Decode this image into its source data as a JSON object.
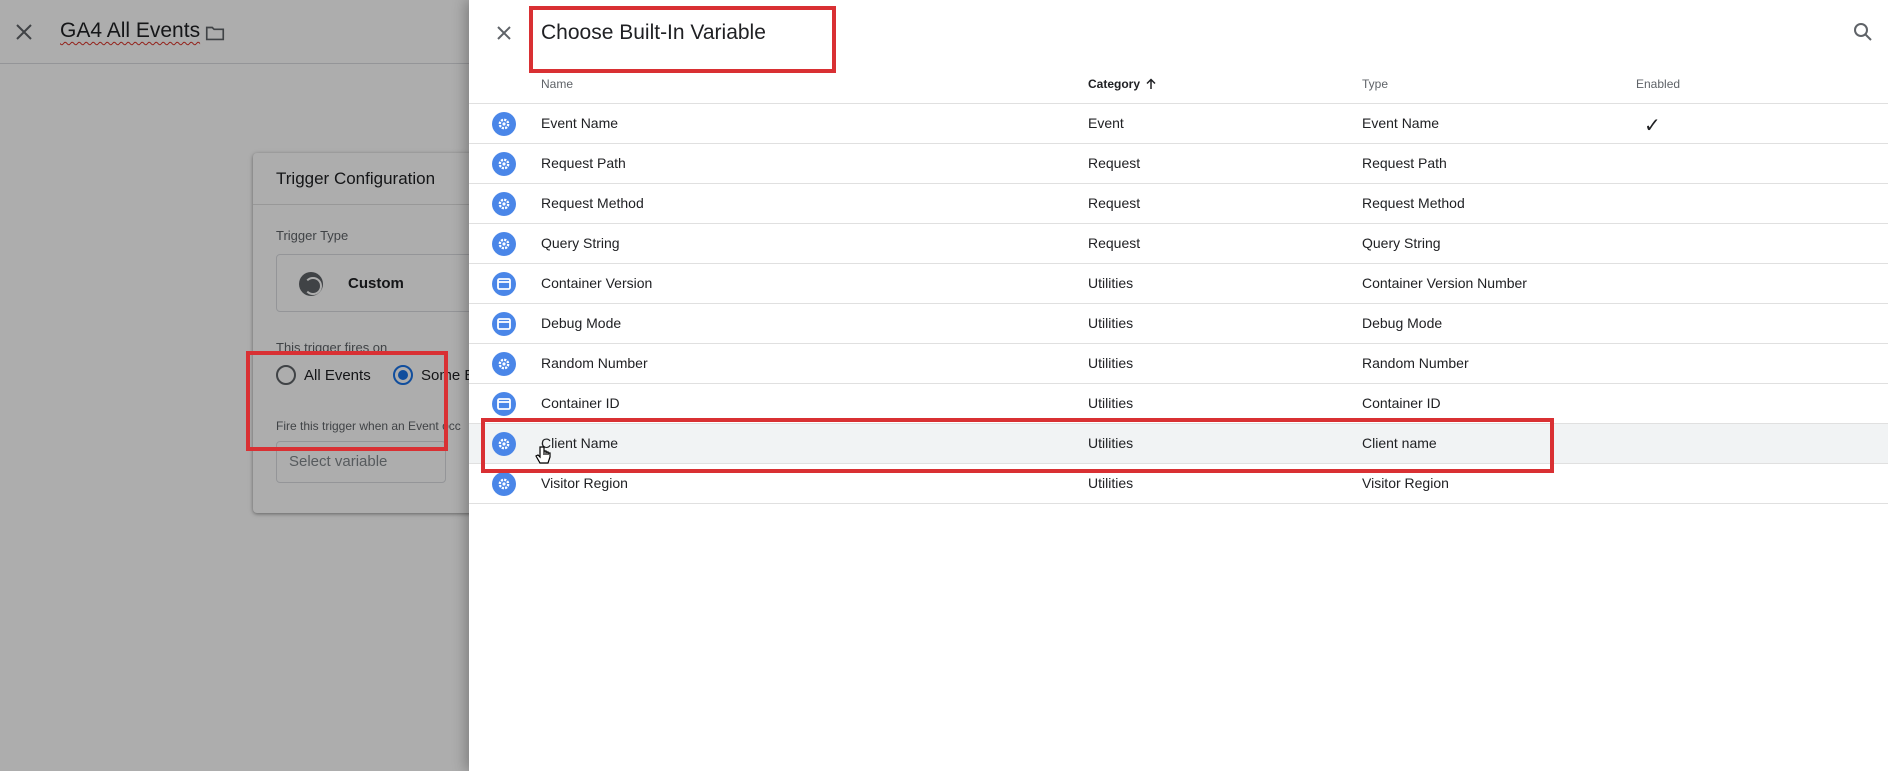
{
  "editor": {
    "title": "GA4 All Events",
    "card": {
      "title": "Trigger Configuration",
      "trigger_type_label": "Trigger Type",
      "trigger_type_value": "Custom",
      "fires_on_label": "This trigger fires on",
      "option_all": "All Events",
      "option_some": "Some E",
      "condition_label": "Fire this trigger when an Event occ",
      "select_placeholder": "Select variable"
    }
  },
  "panel": {
    "title": "Choose Built-In Variable",
    "columns": {
      "name": "Name",
      "category": "Category",
      "type": "Type",
      "enabled": "Enabled"
    },
    "rows": [
      {
        "name": "Event Name",
        "category": "Event",
        "type": "Event Name",
        "enabled": "✓",
        "icon": "gear-icon"
      },
      {
        "name": "Request Path",
        "category": "Request",
        "type": "Request Path",
        "enabled": "",
        "icon": "gear-icon"
      },
      {
        "name": "Request Method",
        "category": "Request",
        "type": "Request Method",
        "enabled": "",
        "icon": "gear-icon"
      },
      {
        "name": "Query String",
        "category": "Request",
        "type": "Query String",
        "enabled": "",
        "icon": "gear-icon"
      },
      {
        "name": "Container Version",
        "category": "Utilities",
        "type": "Container Version Number",
        "enabled": "",
        "icon": "container-icon"
      },
      {
        "name": "Debug Mode",
        "category": "Utilities",
        "type": "Debug Mode",
        "enabled": "",
        "icon": "container-icon"
      },
      {
        "name": "Random Number",
        "category": "Utilities",
        "type": "Random Number",
        "enabled": "",
        "icon": "gear-icon"
      },
      {
        "name": "Container ID",
        "category": "Utilities",
        "type": "Container ID",
        "enabled": "",
        "icon": "container-icon"
      },
      {
        "name": "Client Name",
        "category": "Utilities",
        "type": "Client name",
        "enabled": "",
        "icon": "gear-icon"
      },
      {
        "name": "Visitor Region",
        "category": "Utilities",
        "type": "Visitor Region",
        "enabled": "",
        "icon": "gear-icon"
      }
    ]
  },
  "colors": {
    "accent": "#1a73e8",
    "icon_blue": "#4a86e8",
    "highlight_red": "#d93033",
    "selected_row": "#f1f3f4"
  }
}
